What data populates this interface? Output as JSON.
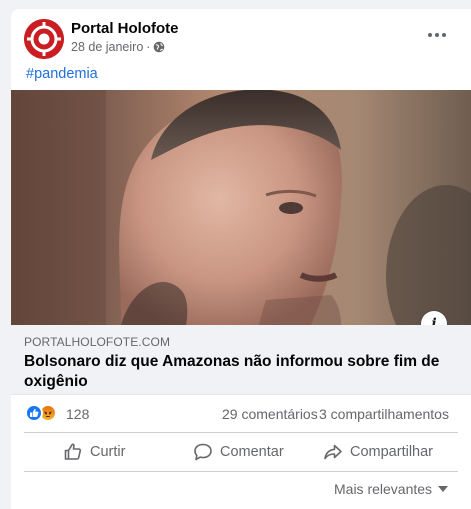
{
  "post": {
    "page_name": "Portal Holofote",
    "date": "28 de janeiro",
    "separator": "·",
    "privacy_icon": "globe-icon",
    "more_icon": "ellipsis-icon",
    "hashtag": "#pandemia"
  },
  "link_preview": {
    "domain": "PORTALHOLOFOTE.COM",
    "title": "Bolsonaro diz que Amazonas não informou sobre fim de oxigênio",
    "info_icon": "info-icon"
  },
  "engagement": {
    "reactions": [
      "like",
      "angry"
    ],
    "reaction_count": "128",
    "comments": "29 comentários",
    "shares": "3 compartilhamentos"
  },
  "actions": {
    "like": "Curtir",
    "comment": "Comentar",
    "share": "Compartilhar"
  },
  "comments_sort": {
    "label": "Mais relevantes"
  },
  "colors": {
    "link_blue": "#216fdb",
    "like_blue": "#1877f2",
    "secondary_text": "#65676b",
    "preview_bg": "#f0f2f5",
    "brand_red": "#c91e22"
  }
}
